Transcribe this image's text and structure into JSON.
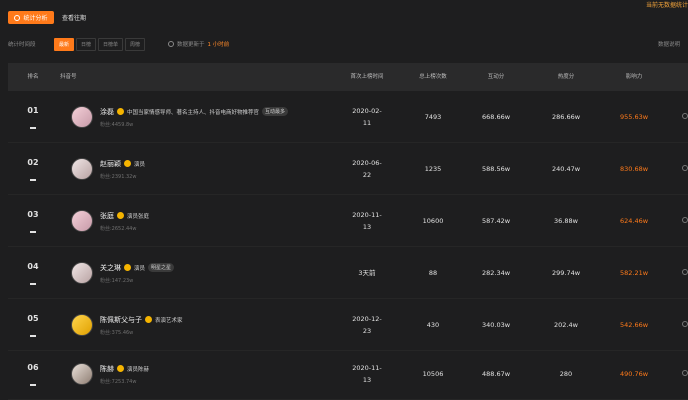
{
  "toolbar": {
    "analysis_label": "统计分析",
    "history_label": "查看往期",
    "corner_tag": "当前无数据统计"
  },
  "filter": {
    "label": "统计时间段",
    "tabs": [
      {
        "label": "最新"
      },
      {
        "label": "日榜"
      },
      {
        "label": "日榜单"
      },
      {
        "label": "周榜"
      }
    ],
    "update_prefix": "数据更新于",
    "update_value": "1 小时前",
    "data_note": "数据说明"
  },
  "table": {
    "headers": {
      "rank": "排名",
      "account": "抖音号",
      "first_listed": "首次上榜时间",
      "list_count": "总上榜次数",
      "interaction": "互动分",
      "heat": "热度分",
      "influence": "影响力"
    },
    "rows": [
      {
        "rank": "01",
        "name": "涂磊",
        "desc": "中国当家情感导师、著名主持人、抖音电商好物推荐官",
        "chip": "互动最多",
        "fans": "粉丝:4459.8w",
        "date1": "2020-02-",
        "date2": "11",
        "count": "7493",
        "interaction": "668.66w",
        "heat": "286.66w",
        "influence": "955.63w"
      },
      {
        "rank": "02",
        "name": "赵丽颖",
        "desc": "演员",
        "chip": "",
        "fans": "粉丝:2391.32w",
        "date1": "2020-06-",
        "date2": "22",
        "count": "1235",
        "interaction": "588.56w",
        "heat": "240.47w",
        "influence": "830.68w"
      },
      {
        "rank": "03",
        "name": "张庭",
        "desc": "演员张庭",
        "chip": "",
        "fans": "粉丝:2652.44w",
        "date1": "2020-11-",
        "date2": "13",
        "count": "10600",
        "interaction": "587.42w",
        "heat": "36.88w",
        "influence": "624.46w"
      },
      {
        "rank": "04",
        "name": "关之琳",
        "desc": "演员",
        "chip": "明星之星",
        "fans": "粉丝:147.23w",
        "date1": "3天前",
        "date2": "",
        "count": "88",
        "interaction": "282.34w",
        "heat": "299.74w",
        "influence": "582.21w"
      },
      {
        "rank": "05",
        "name": "陈佩斯父与子",
        "desc": "表演艺术家",
        "chip": "",
        "fans": "粉丝:375.46w",
        "date1": "2020-12-",
        "date2": "23",
        "count": "430",
        "interaction": "340.03w",
        "heat": "202.4w",
        "influence": "542.66w"
      },
      {
        "rank": "06",
        "name": "陈赫",
        "desc": "演员陈赫",
        "chip": "",
        "fans": "粉丝:7253.74w",
        "date1": "2020-11-",
        "date2": "13",
        "count": "10506",
        "interaction": "488.67w",
        "heat": "280",
        "influence": "490.76w"
      }
    ]
  }
}
